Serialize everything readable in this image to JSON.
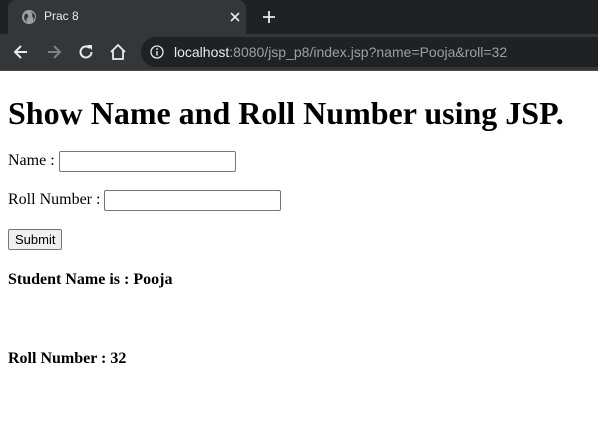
{
  "browser": {
    "tab_title": "Prac 8",
    "url_host": "localhost",
    "url_rest": ":8080/jsp_p8/index.jsp?name=Pooja&roll=32",
    "icons": [
      "globe-icon",
      "close-icon",
      "plus-icon",
      "back-arrow-icon",
      "forward-arrow-icon",
      "reload-icon",
      "home-icon",
      "info-icon"
    ],
    "colors": {
      "tabbar_bg": "#202124",
      "toolbar_bg": "#35363a",
      "omnibox_bg": "#202124"
    }
  },
  "page": {
    "heading": "Show Name and Roll Number using JSP.",
    "form": {
      "name_label": "Name :",
      "name_value": "",
      "roll_label": "Roll Number :",
      "roll_value": "",
      "submit_label": "Submit"
    },
    "results": {
      "name_text": "Student Name is : Pooja",
      "roll_text": "Roll Number : 32"
    }
  }
}
